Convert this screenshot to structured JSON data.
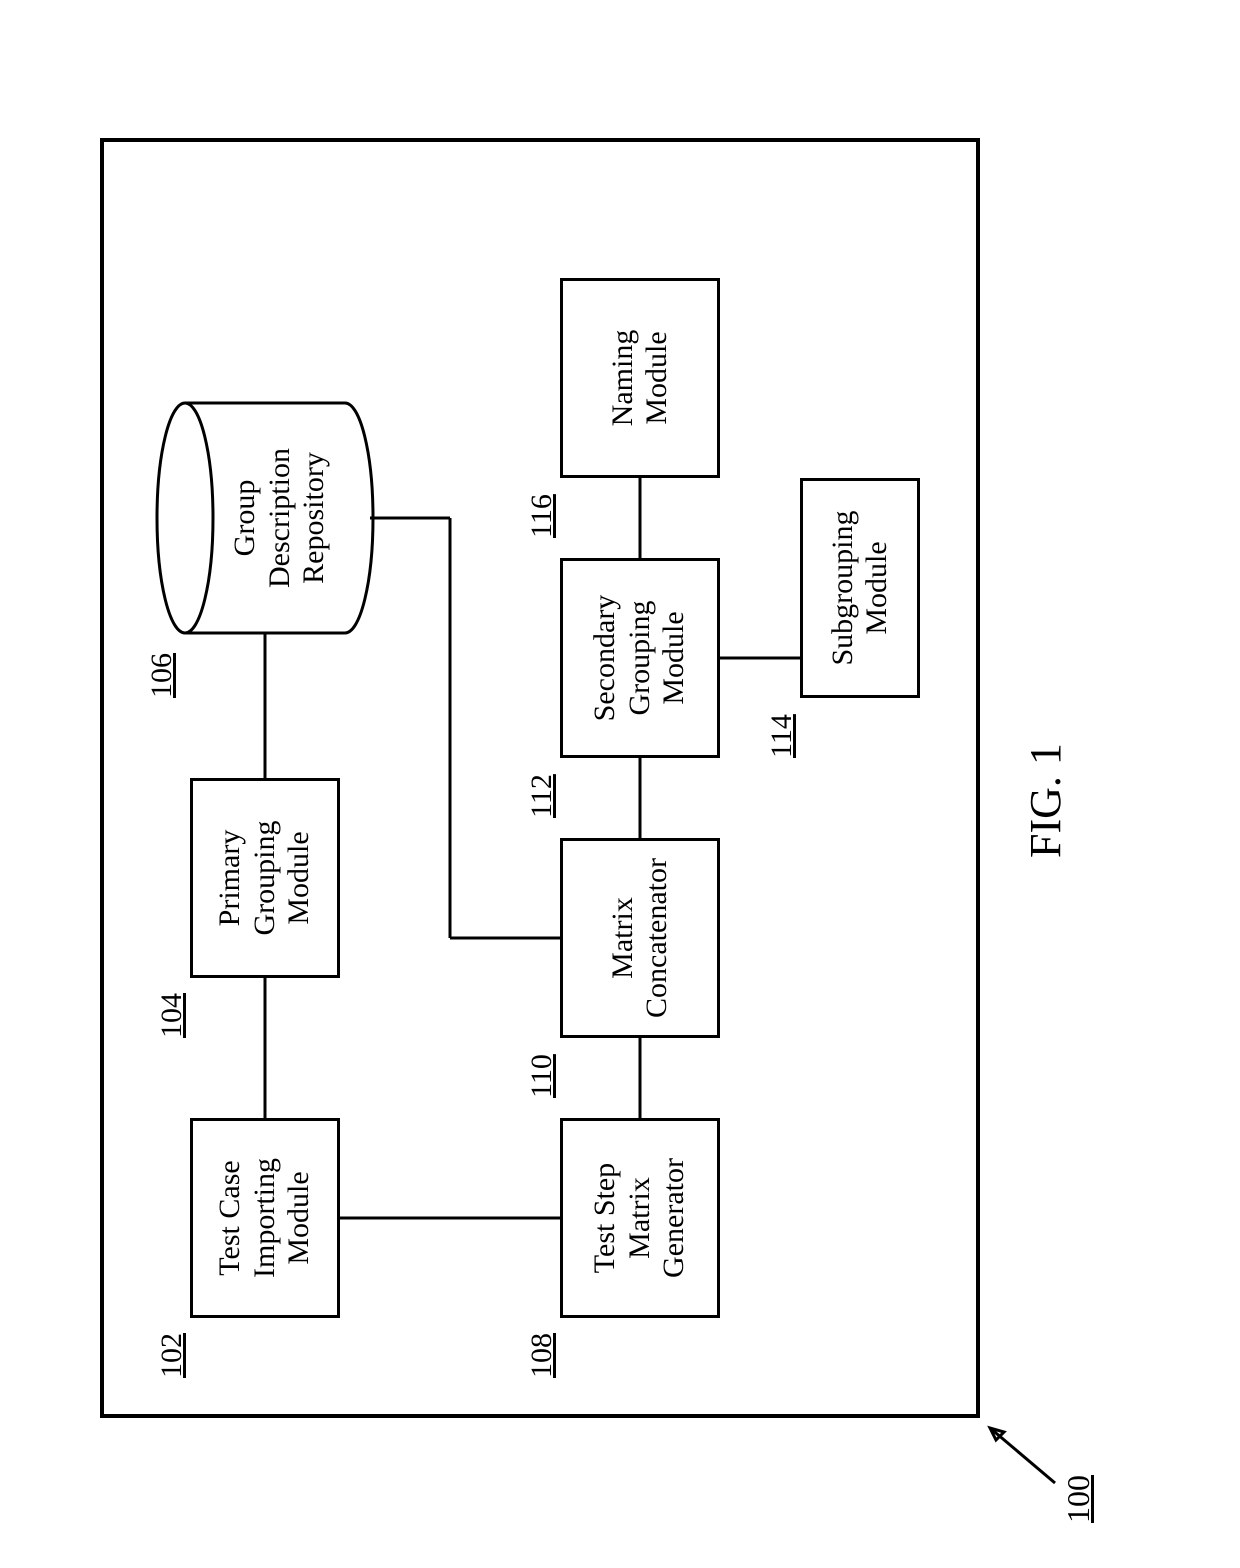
{
  "figure_caption": "FIG. 1",
  "system_ref": "100",
  "blocks": {
    "b102": {
      "ref": "102",
      "text": "Test Case\nImporting\nModule"
    },
    "b104": {
      "ref": "104",
      "text": "Primary\nGrouping\nModule"
    },
    "b106": {
      "ref": "106",
      "text": "Group\nDescription\nRepository"
    },
    "b108": {
      "ref": "108",
      "text": "Test Step\nMatrix\nGenerator"
    },
    "b110": {
      "ref": "110",
      "text": "Matrix\nConcatenator"
    },
    "b112": {
      "ref": "112",
      "text": "Secondary\nGrouping\nModule"
    },
    "b114": {
      "ref": "114",
      "text": "Subgrouping\nModule"
    },
    "b116": {
      "ref": "116",
      "text": "Naming\nModule"
    }
  }
}
